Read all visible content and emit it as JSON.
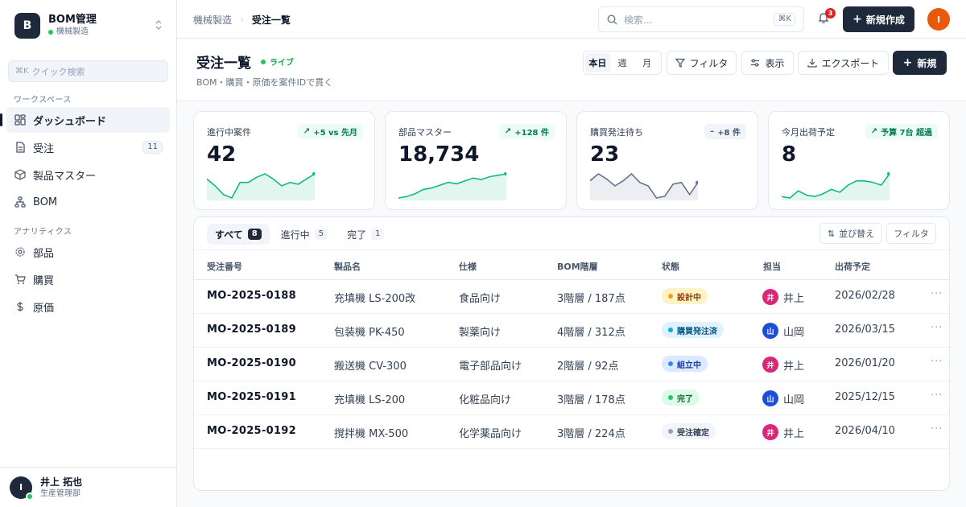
{
  "sidebar": {
    "brand": {
      "logo": "B",
      "name": "BOM管理",
      "sub": "機械製造"
    },
    "quick_search": {
      "kbd": "⌘K",
      "placeholder": "クイック検索"
    },
    "workspace_label": "ワークスペース",
    "workspace_items": [
      {
        "label": "ダッシュボード",
        "icon": "dashboard-icon",
        "active": true
      },
      {
        "label": "受注",
        "icon": "document-icon",
        "count": "11"
      },
      {
        "label": "製品マスター",
        "icon": "cube-icon"
      },
      {
        "label": "BOM",
        "icon": "tree-icon"
      }
    ],
    "analytics_label": "アナリティクス",
    "analytics_items": [
      {
        "label": "部品",
        "icon": "gear-icon"
      },
      {
        "label": "購買",
        "icon": "cart-icon"
      },
      {
        "label": "原価",
        "icon": "dollar-icon"
      }
    ],
    "user": {
      "initial": "I",
      "name": "井上 拓也",
      "dept": "生産管理部"
    }
  },
  "topbar": {
    "breadcrumb": [
      "機械製造",
      "受注一覧"
    ],
    "search": {
      "placeholder": "検索...",
      "kbd": "⌘K"
    },
    "notifications": "3",
    "new_button": "新規作成",
    "avatar": "I"
  },
  "header": {
    "title": "受注一覧",
    "live": "ライブ",
    "subtitle": "BOM・購買・原価を案件IDで貫く",
    "periods": [
      "本日",
      "週",
      "月"
    ],
    "filter": "フィルタ",
    "view": "表示",
    "export": "エクスポート",
    "new": "新規"
  },
  "kpis": [
    {
      "label": "進行中案件",
      "value": "42",
      "delta": "+5 vs 先月",
      "trend": "up",
      "color": "#10b981",
      "spark": [
        14,
        10,
        5,
        3,
        12,
        12,
        15,
        17,
        14,
        10,
        12,
        11,
        14,
        17
      ]
    },
    {
      "label": "部品マスター",
      "value": "18,734",
      "delta": "+128 件",
      "trend": "up",
      "color": "#10b981",
      "spark": [
        3,
        4,
        6,
        9,
        10,
        12,
        14,
        13,
        15,
        17,
        16,
        18,
        19,
        20
      ]
    },
    {
      "label": "購買発注待ち",
      "value": "23",
      "delta": "+8 件",
      "trend": "neutral",
      "color": "#64748b",
      "spark": [
        16,
        20,
        17,
        13,
        16,
        20,
        15,
        13,
        6,
        7,
        14,
        15,
        8,
        15
      ]
    },
    {
      "label": "今月出荷予定",
      "value": "8",
      "delta": "予算 7台 超過",
      "trend": "up",
      "color": "#10b981",
      "spark": [
        4,
        3,
        8,
        5,
        4,
        6,
        9,
        7,
        12,
        15,
        15,
        14,
        12,
        20
      ]
    }
  ],
  "table": {
    "tabs": [
      {
        "label": "すべて",
        "count": "8",
        "active": true
      },
      {
        "label": "進行中",
        "count": "5"
      },
      {
        "label": "完了",
        "count": "1"
      }
    ],
    "sort_label": "並び替え",
    "filter_label": "フィルタ",
    "columns": [
      "受注番号",
      "製品名",
      "仕様",
      "BOM階層",
      "状態",
      "担当",
      "出荷予定"
    ],
    "rows": [
      {
        "id": "MO-2025-0188",
        "product": "充填機 LS-200改",
        "spec": "食品向け",
        "bom": "3階層 / 187点",
        "status": "設計中",
        "status_bg": "#fef3c7",
        "status_fg": "#92400e",
        "status_dot": "#f59e0b",
        "owner": "井上",
        "owner_initial": "井",
        "owner_color": "#db2777",
        "ship": "2026/02/28"
      },
      {
        "id": "MO-2025-0189",
        "product": "包装機 PK-450",
        "spec": "製薬向け",
        "bom": "4階層 / 312点",
        "status": "購買発注済",
        "status_bg": "#e0f2fe",
        "status_fg": "#075985",
        "status_dot": "#0ea5e9",
        "owner": "山岡",
        "owner_initial": "山",
        "owner_color": "#1d4ed8",
        "ship": "2026/03/15"
      },
      {
        "id": "MO-2025-0190",
        "product": "搬送機 CV-300",
        "spec": "電子部品向け",
        "bom": "2階層 / 92点",
        "status": "組立中",
        "status_bg": "#dbeafe",
        "status_fg": "#1e40af",
        "status_dot": "#3b82f6",
        "owner": "井上",
        "owner_initial": "井",
        "owner_color": "#db2777",
        "ship": "2026/01/20"
      },
      {
        "id": "MO-2025-0191",
        "product": "充填機 LS-200",
        "spec": "化粧品向け",
        "bom": "3階層 / 178点",
        "status": "完了",
        "status_bg": "#dcfce7",
        "status_fg": "#166534",
        "status_dot": "#22c55e",
        "owner": "山岡",
        "owner_initial": "山",
        "owner_color": "#1d4ed8",
        "ship": "2025/12/15"
      },
      {
        "id": "MO-2025-0192",
        "product": "撹拌機 MX-500",
        "spec": "化学薬品向け",
        "bom": "3階層 / 224点",
        "status": "受注確定",
        "status_bg": "#f1f5f9",
        "status_fg": "#334155",
        "status_dot": "#94a3b8",
        "owner": "井上",
        "owner_initial": "井",
        "owner_color": "#db2777",
        "ship": "2026/04/10"
      }
    ]
  }
}
